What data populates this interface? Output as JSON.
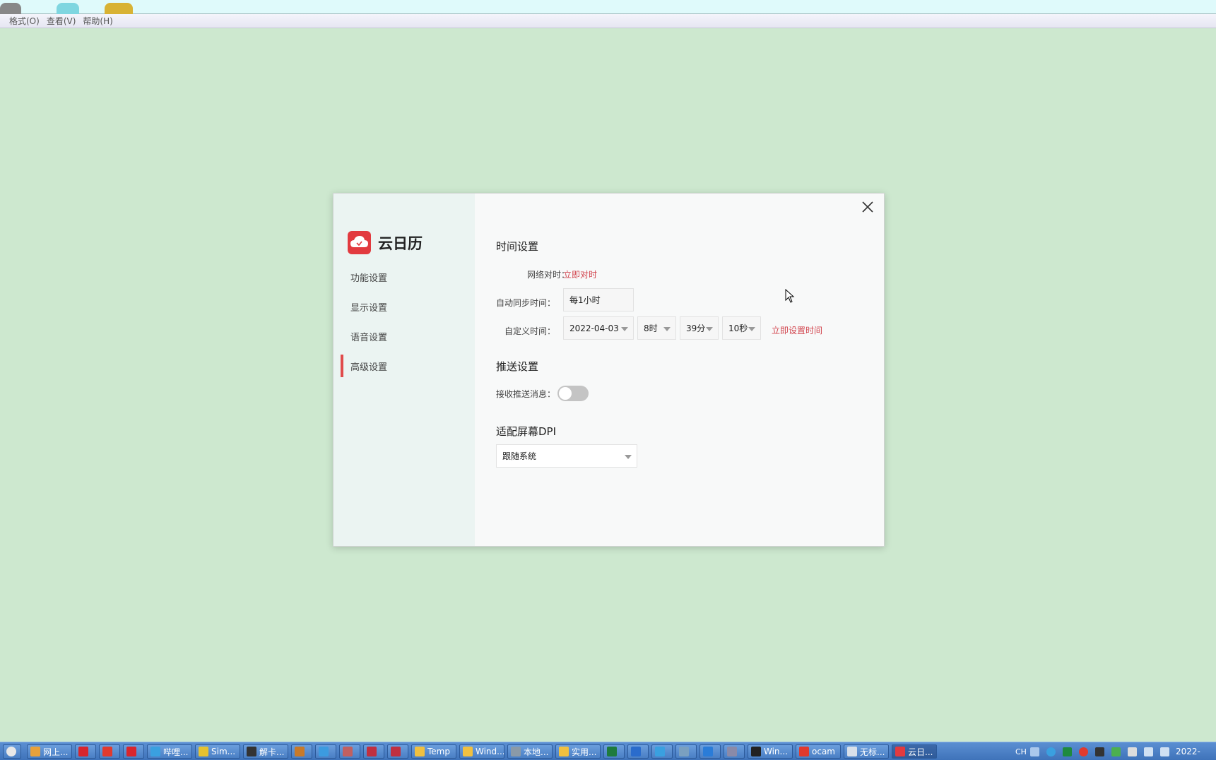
{
  "menubar": {
    "items": [
      "格式(O)",
      "查看(V)",
      "帮助(H)"
    ]
  },
  "dialog": {
    "app_name": "云日历",
    "nav": [
      "功能设置",
      "显示设置",
      "语音设置",
      "高级设置"
    ],
    "active_nav": "高级设置",
    "time_section": {
      "title": "时间设置",
      "net_sync_label": "网络对时：",
      "net_sync_link": "立即对时",
      "auto_sync_label": "自动同步时间：",
      "auto_sync_value": "每1小时",
      "custom_time_label": "自定义时间：",
      "date_value": "2022-04-03",
      "hour_value": "8时",
      "minute_value": "39分",
      "second_value": "10秒",
      "set_time_link": "立即设置时间"
    },
    "push_section": {
      "title": "推送设置",
      "receive_label": "接收推送消息：",
      "receive_enabled": false
    },
    "dpi_section": {
      "title": "适配屏幕DPI",
      "value": "跟随系统"
    }
  },
  "taskbar": {
    "items": [
      {
        "label": "网上...",
        "icon_color": "#e8a13a"
      },
      {
        "label": "",
        "icon_color": "#d8262d"
      },
      {
        "label": "",
        "icon_color": "#e03a2e"
      },
      {
        "label": "",
        "icon_color": "#d8262d"
      },
      {
        "label": "哔哩...",
        "icon_color": "#3aa0e0"
      },
      {
        "label": "Sim...",
        "icon_color": "#e5c230"
      },
      {
        "label": "解卡...",
        "icon_color": "#333333"
      },
      {
        "label": "",
        "icon_color": "#c87a2a"
      },
      {
        "label": "",
        "icon_color": "#3c9be0"
      },
      {
        "label": "",
        "icon_color": "#c06060"
      },
      {
        "label": "",
        "icon_color": "#c03040"
      },
      {
        "label": "",
        "icon_color": "#c03040"
      },
      {
        "label": "Temp",
        "icon_color": "#f0c040"
      },
      {
        "label": "Wind...",
        "icon_color": "#f0c040"
      },
      {
        "label": "本地...",
        "icon_color": "#8a9aa8"
      },
      {
        "label": "实用...",
        "icon_color": "#f0c040"
      },
      {
        "label": "",
        "icon_color": "#1e7b3e"
      },
      {
        "label": "",
        "icon_color": "#2a6ccc"
      },
      {
        "label": "",
        "icon_color": "#3aa0e0"
      },
      {
        "label": "",
        "icon_color": "#7aa0c0"
      },
      {
        "label": "",
        "icon_color": "#2a7cd8"
      },
      {
        "label": "",
        "icon_color": "#8a8aa8"
      },
      {
        "label": "Win...",
        "icon_color": "#222222"
      },
      {
        "label": "ocam",
        "icon_color": "#e03a2e"
      },
      {
        "label": "无标...",
        "icon_color": "#d8e0ea"
      },
      {
        "label": "云日...",
        "icon_color": "#e23a3f"
      }
    ],
    "tray_lang": "CH",
    "clock": "2022-"
  },
  "colors": {
    "desktop_bg": "#cde8cf",
    "accent_red": "#d2464f",
    "brand_red": "#e23a3f",
    "sidebar_bg": "#ebf4f2"
  }
}
